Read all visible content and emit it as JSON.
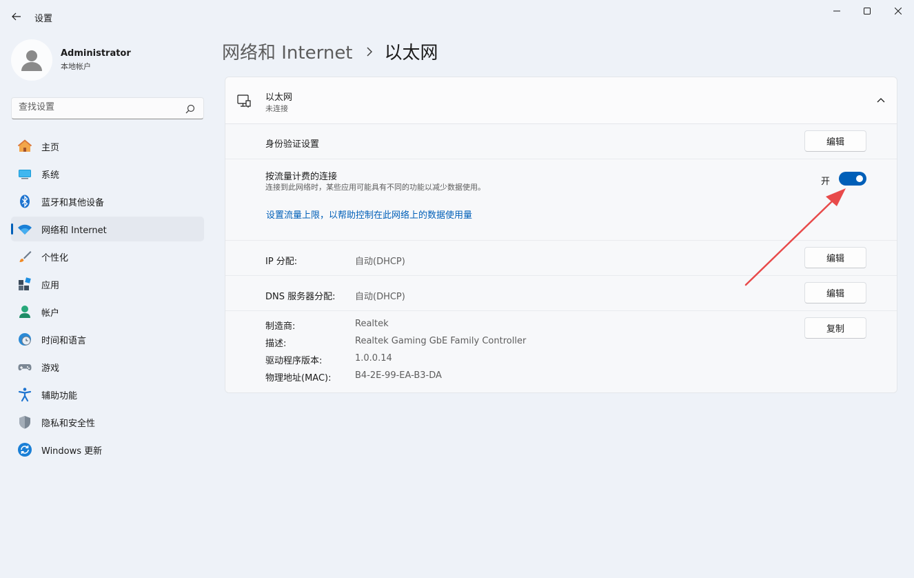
{
  "window": {
    "title": "设置"
  },
  "profile": {
    "name": "Administrator",
    "account_type": "本地帐户"
  },
  "search": {
    "placeholder": "查找设置"
  },
  "sidebar": {
    "items": [
      {
        "label": "主页",
        "icon": "home-icon"
      },
      {
        "label": "系统",
        "icon": "system-icon"
      },
      {
        "label": "蓝牙和其他设备",
        "icon": "bluetooth-icon"
      },
      {
        "label": "网络和 Internet",
        "icon": "wifi-icon",
        "active": true
      },
      {
        "label": "个性化",
        "icon": "brush-icon"
      },
      {
        "label": "应用",
        "icon": "apps-icon"
      },
      {
        "label": "帐户",
        "icon": "account-icon"
      },
      {
        "label": "时间和语言",
        "icon": "clock-globe-icon"
      },
      {
        "label": "游戏",
        "icon": "gamepad-icon"
      },
      {
        "label": "辅助功能",
        "icon": "accessibility-icon"
      },
      {
        "label": "隐私和安全性",
        "icon": "shield-icon"
      },
      {
        "label": "Windows 更新",
        "icon": "update-icon"
      }
    ]
  },
  "breadcrumb": {
    "parent": "网络和 Internet",
    "current": "以太网"
  },
  "ethernet": {
    "title": "以太网",
    "status": "未连接",
    "auth": {
      "label": "身份验证设置",
      "button": "编辑"
    },
    "metered": {
      "label": "按流量计费的连接",
      "description": "连接到此网络时，某些应用可能具有不同的功能以减少数据使用。",
      "toggle_state": "开",
      "toggle_on": true,
      "link": "设置流量上限，以帮助控制在此网络上的数据使用量"
    },
    "ip": {
      "label": "IP 分配:",
      "value": "自动(DHCP)",
      "button": "编辑"
    },
    "dns": {
      "label": "DNS 服务器分配:",
      "value": "自动(DHCP)",
      "button": "编辑"
    },
    "details": {
      "manufacturer_label": "制造商:",
      "manufacturer": "Realtek",
      "description_label": "描述:",
      "description": "Realtek Gaming GbE Family Controller",
      "driver_label": "驱动程序版本:",
      "driver": "1.0.0.14",
      "mac_label": "物理地址(MAC):",
      "mac": "B4-2E-99-EA-B3-DA",
      "copy_button": "复制"
    }
  },
  "colors": {
    "accent": "#005fb8",
    "annotation_arrow": "#e84a4a"
  }
}
